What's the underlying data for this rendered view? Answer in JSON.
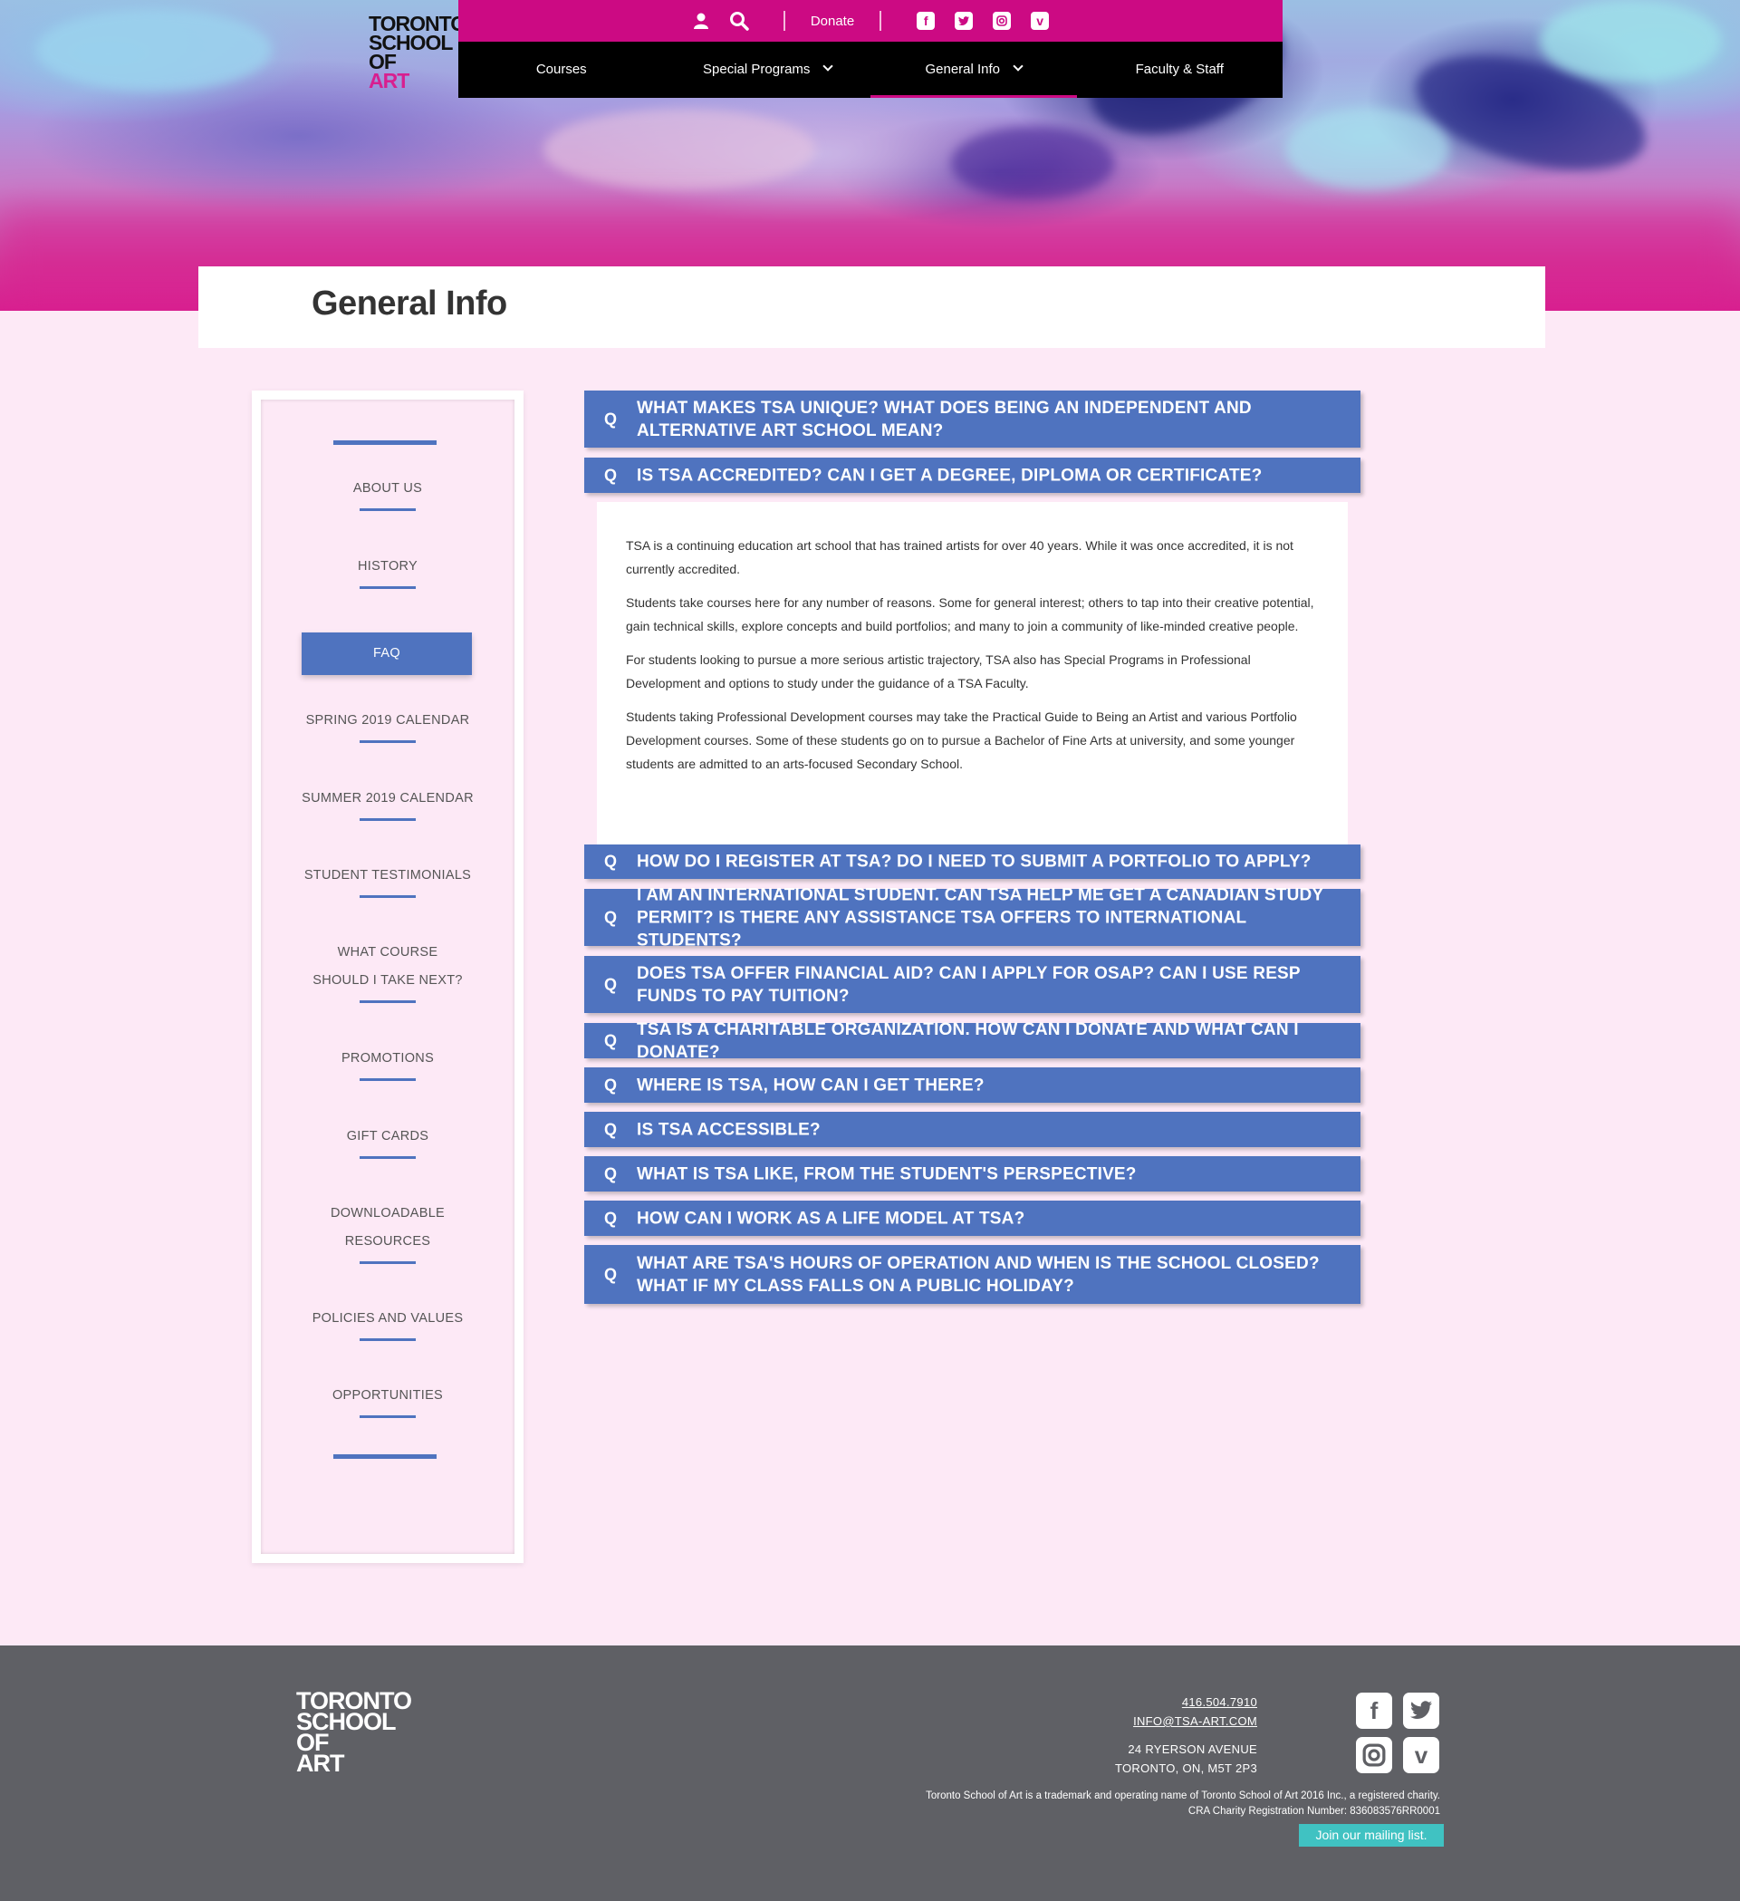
{
  "brand": {
    "logo_lines": [
      "TORONTO",
      "SCHOOL",
      "OF"
    ],
    "logo_accent": "ART",
    "accent_color": "#cc0a83",
    "primary_color": "#4f73bf"
  },
  "topbar": {
    "donate_label": "Donate",
    "icons": [
      "user-icon",
      "search-icon",
      "facebook-icon",
      "twitter-icon",
      "instagram-icon",
      "vimeo-icon"
    ]
  },
  "nav": {
    "items": [
      {
        "label": "Courses",
        "has_dropdown": false
      },
      {
        "label": "Special Programs",
        "has_dropdown": true
      },
      {
        "label": "General Info",
        "has_dropdown": true,
        "active": true
      },
      {
        "label": "Faculty & Staff",
        "has_dropdown": false
      }
    ]
  },
  "page": {
    "title": "General Info"
  },
  "sidebar": {
    "items": [
      {
        "label": "ABOUT US"
      },
      {
        "label": "HISTORY"
      },
      {
        "label": "FAQ",
        "active": true
      },
      {
        "label": "SPRING 2019 CALENDAR"
      },
      {
        "label": "SUMMER 2019 CALENDAR"
      },
      {
        "label": "STUDENT TESTIMONIALS"
      },
      {
        "label": "WHAT COURSE SHOULD I TAKE NEXT?"
      },
      {
        "label": "PROMOTIONS"
      },
      {
        "label": "GIFT CARDS"
      },
      {
        "label": "DOWNLOADABLE RESOURCES"
      },
      {
        "label": "POLICIES AND VALUES"
      },
      {
        "label": "OPPORTUNITIES"
      }
    ]
  },
  "faq": {
    "q_marker": "Q",
    "items": [
      {
        "question": "What makes TSA unique? What does being an independent and alternative art school mean?"
      },
      {
        "question": "Is TSA accredited? Can I get a degree, diploma or certificate?",
        "expanded": true
      },
      {
        "question": "How do I register at TSA? Do I need to submit a portfolio to apply?"
      },
      {
        "question": "I am an international student. Can TSA help me get a Canadian study permit? Is there any assistance TSA offers to international students?"
      },
      {
        "question": "Does TSA offer financial aid? Can I apply for OSAP? Can I use RESP funds to pay tuition?"
      },
      {
        "question": "TSA is a charitable organization. How can I donate and what can I donate?"
      },
      {
        "question": "Where is TSA, how can I get there?"
      },
      {
        "question": "Is TSA accessible?"
      },
      {
        "question": "What is TSA like, from the student's perspective?"
      },
      {
        "question": "How can I work as a life model at TSA?"
      },
      {
        "question": "What are TSA's hours of operation and when is the school closed? What if my class falls on a public holiday?"
      }
    ],
    "answer": [
      "TSA is a continuing education art school that has trained artists for over 40 years. While it was once accredited, it is not currently accredited.",
      "Students take courses here for any number of reasons. Some for general interest; others to tap into their creative potential, gain technical skills, explore concepts and build portfolios; and many to join a community of like-minded creative people.",
      "For students looking to pursue a more serious artistic trajectory, TSA also has Special Programs in Professional Development and options to study under the guidance of a TSA Faculty.",
      "Students taking Professional Development courses may take the Practical Guide to Being an Artist and various Portfolio Development courses. Some of these students go on to pursue a Bachelor of Fine Arts at university, and some younger students are admitted to an arts-focused Secondary School."
    ]
  },
  "footer": {
    "logo_lines": [
      "TORONTO",
      "SCHOOL",
      "OF",
      "ART"
    ],
    "phone": "416.504.7910",
    "email": "INFO@TSA-ART.COM",
    "address_line1": "24 RYERSON AVENUE",
    "address_line2": "TORONTO, ON, M5T 2P3",
    "legal_line1": "Toronto School of Art is a trademark and operating name of Toronto School of Art 2016 Inc., a registered charity.",
    "legal_line2": "CRA Charity Registration Number: 836083576RR0001",
    "mailing_list": "Join our mailing list.",
    "social_icons": [
      "facebook-icon",
      "twitter-icon",
      "instagram-icon",
      "vimeo-icon"
    ]
  }
}
